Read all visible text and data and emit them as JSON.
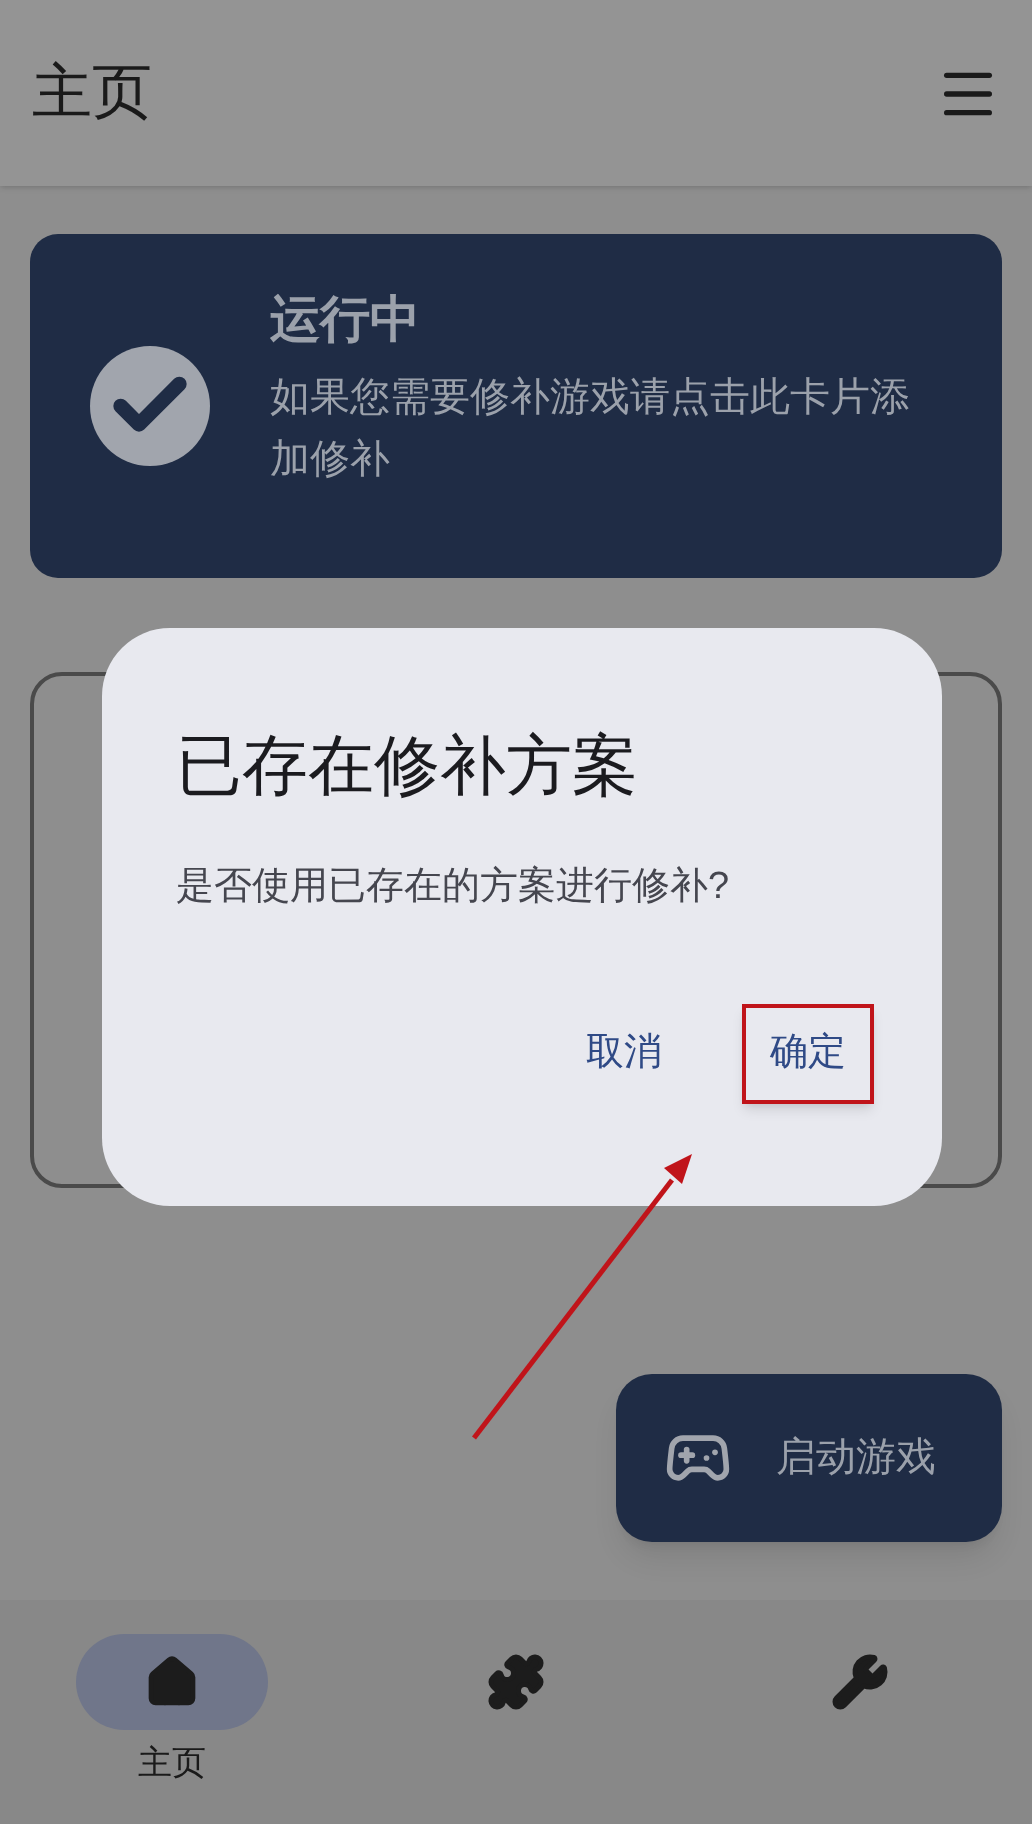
{
  "app_bar": {
    "title": "主页"
  },
  "status_card": {
    "title": "运行中",
    "message": "如果您需要修补游戏请点击此卡片添加修补"
  },
  "dialog": {
    "title": "已存在修补方案",
    "message": "是否使用已存在的方案进行修补?",
    "buttons": [
      {
        "label": "取消",
        "highlighted": false
      },
      {
        "label": "确定",
        "highlighted": true
      }
    ]
  },
  "fab": {
    "label": "启动游戏"
  },
  "nav": [
    {
      "kind": "home",
      "label": "主页",
      "selected": true
    },
    {
      "kind": "puzzle",
      "selected": false
    },
    {
      "kind": "wrench",
      "selected": false
    }
  ]
}
